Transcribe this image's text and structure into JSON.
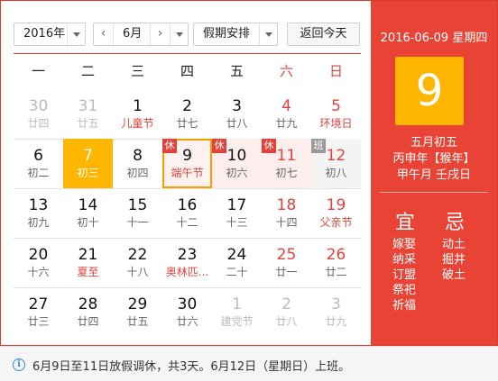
{
  "toolbar": {
    "year": "2016年",
    "month": "6月",
    "prev": "‹",
    "next": "›",
    "holiday": "假期安排",
    "today_button": "返回今天"
  },
  "weekdays": [
    "一",
    "二",
    "三",
    "四",
    "五",
    "六",
    "日"
  ],
  "weeks": [
    [
      {
        "day": "30",
        "lunar": "廿四",
        "other": true
      },
      {
        "day": "31",
        "lunar": "廿五",
        "other": true
      },
      {
        "day": "1",
        "lunar": "儿童节",
        "fest": true
      },
      {
        "day": "2",
        "lunar": "廿七"
      },
      {
        "day": "3",
        "lunar": "廿八"
      },
      {
        "day": "4",
        "lunar": "廿九",
        "weekend": true
      },
      {
        "day": "5",
        "lunar": "环境日",
        "weekend": true,
        "fest": true
      }
    ],
    [
      {
        "day": "6",
        "lunar": "初二"
      },
      {
        "day": "7",
        "lunar": "初三",
        "today": true
      },
      {
        "day": "8",
        "lunar": "初四"
      },
      {
        "day": "9",
        "lunar": "端午节",
        "fest": true,
        "tag": "休",
        "holiday": true,
        "selected": true
      },
      {
        "day": "10",
        "lunar": "初六",
        "tag": "休",
        "holiday": true
      },
      {
        "day": "11",
        "lunar": "初七",
        "tag": "休",
        "holiday": true,
        "weekend": true
      },
      {
        "day": "12",
        "lunar": "初八",
        "tag": "班",
        "work": true,
        "weekend": true
      }
    ],
    [
      {
        "day": "13",
        "lunar": "初九"
      },
      {
        "day": "14",
        "lunar": "初十"
      },
      {
        "day": "15",
        "lunar": "十一"
      },
      {
        "day": "16",
        "lunar": "十二"
      },
      {
        "day": "17",
        "lunar": "十三"
      },
      {
        "day": "18",
        "lunar": "十四",
        "weekend": true
      },
      {
        "day": "19",
        "lunar": "父亲节",
        "weekend": true,
        "fest": true
      }
    ],
    [
      {
        "day": "20",
        "lunar": "十六"
      },
      {
        "day": "21",
        "lunar": "夏至",
        "fest": true
      },
      {
        "day": "22",
        "lunar": "十八"
      },
      {
        "day": "23",
        "lunar": "奥林匹...",
        "fest": true
      },
      {
        "day": "24",
        "lunar": "二十"
      },
      {
        "day": "25",
        "lunar": "廿一",
        "weekend": true
      },
      {
        "day": "26",
        "lunar": "廿二",
        "weekend": true
      }
    ],
    [
      {
        "day": "27",
        "lunar": "廿三"
      },
      {
        "day": "28",
        "lunar": "廿四"
      },
      {
        "day": "29",
        "lunar": "廿五"
      },
      {
        "day": "30",
        "lunar": "廿六"
      },
      {
        "day": "1",
        "lunar": "建党节",
        "other": true
      },
      {
        "day": "2",
        "lunar": "廿八",
        "other": true
      },
      {
        "day": "3",
        "lunar": "廿九",
        "other": true
      }
    ]
  ],
  "detail": {
    "date_line": "2016-06-09 星期四",
    "big_day": "9",
    "lunar_date": "五月初五",
    "ganzhi_year": "丙申年【猴年】",
    "ganzhi_month_day": "甲午月 壬戌日",
    "yi_title": "宜",
    "ji_title": "忌",
    "yi": [
      "嫁娶",
      "纳采",
      "订盟",
      "祭祀",
      "祈福"
    ],
    "ji": [
      "动土",
      "掘井",
      "破土"
    ]
  },
  "footer": {
    "icon": "i",
    "message": "6月9日至11日放假调休，共3天。6月12日（星期日）上班。"
  },
  "colors": {
    "accent_red": "#e84335",
    "today_orange": "#ffb600",
    "border_red": "#d53a2c"
  }
}
